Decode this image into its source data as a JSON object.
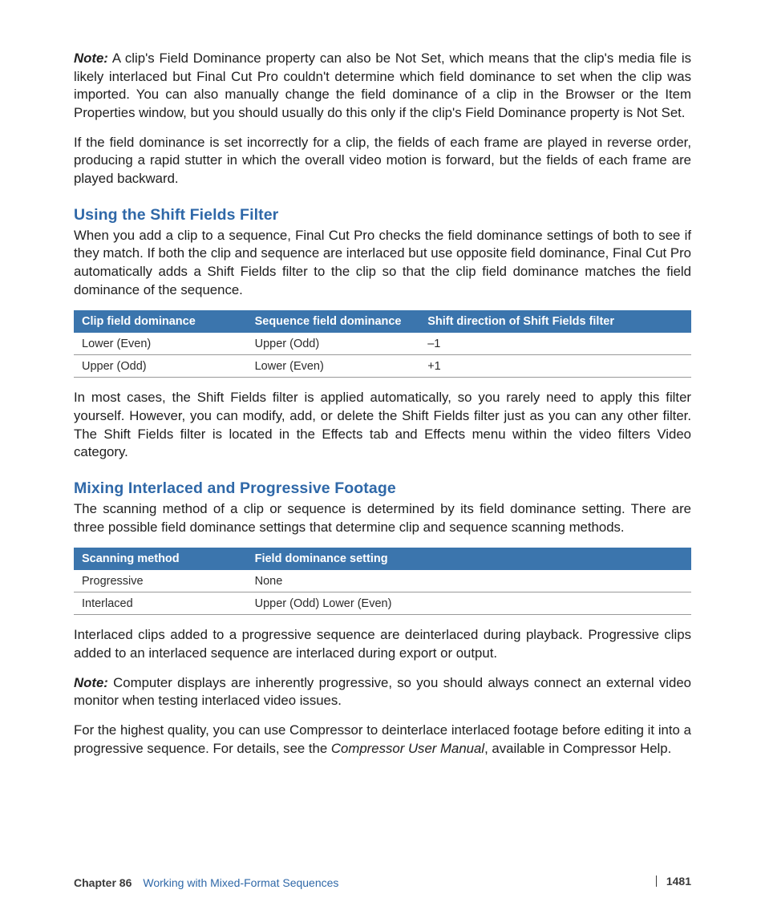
{
  "intro": {
    "note_label": "Note:",
    "note_text": "A clip's Field Dominance property can also be Not Set, which means that the clip's media file is likely interlaced but Final Cut Pro couldn't determine which field dominance to set when the clip was imported. You can also manually change the field dominance of a clip in the Browser or the Item Properties window, but you should usually do this only if the clip's Field Dominance property is Not Set.",
    "p2": "If the field dominance is set incorrectly for a clip, the fields of each frame are played in reverse order, producing a rapid stutter in which the overall video motion is forward, but the fields of each frame are played backward."
  },
  "section1": {
    "heading": "Using the Shift Fields Filter",
    "p1": "When you add a clip to a sequence, Final Cut Pro checks the field dominance settings of both to see if they match. If both the clip and sequence are interlaced but use opposite field dominance, Final Cut Pro automatically adds a Shift Fields filter to the clip so that the clip field dominance matches the field dominance of the sequence.",
    "table": {
      "headers": [
        "Clip field dominance",
        "Sequence field dominance",
        "Shift direction of Shift Fields filter"
      ],
      "rows": [
        [
          "Lower (Even)",
          "Upper (Odd)",
          "–1"
        ],
        [
          "Upper (Odd)",
          "Lower (Even)",
          "+1"
        ]
      ]
    },
    "p2": "In most cases, the Shift Fields filter is applied automatically, so you rarely need to apply this filter yourself. However, you can modify, add, or delete the Shift Fields filter just as you can any other filter. The Shift Fields filter is located in the Effects tab and Effects menu within the video filters Video category."
  },
  "section2": {
    "heading": "Mixing Interlaced and Progressive Footage",
    "p1": "The scanning method of a clip or sequence is determined by its field dominance setting. There are three possible field dominance settings that determine clip and sequence scanning methods.",
    "table": {
      "headers": [
        "Scanning method",
        "Field dominance setting"
      ],
      "rows": [
        [
          "Progressive",
          "None"
        ],
        [
          "Interlaced",
          "Upper (Odd) Lower (Even)"
        ]
      ]
    },
    "p2": "Interlaced clips added to a progressive sequence are deinterlaced during playback. Progressive clips added to an interlaced sequence are interlaced during export or output.",
    "note_label": "Note:",
    "note_text": "Computer displays are inherently progressive, so you should always connect an external video monitor when testing interlaced video issues.",
    "p3a": "For the highest quality, you can use Compressor to deinterlace interlaced footage before editing it into a progressive sequence. For details, see the ",
    "p3_italic": "Compressor User Manual",
    "p3b": ", available in Compressor Help."
  },
  "footer": {
    "chapter_label": "Chapter 86",
    "chapter_title": "Working with Mixed-Format Sequences",
    "page_number": "1481"
  }
}
